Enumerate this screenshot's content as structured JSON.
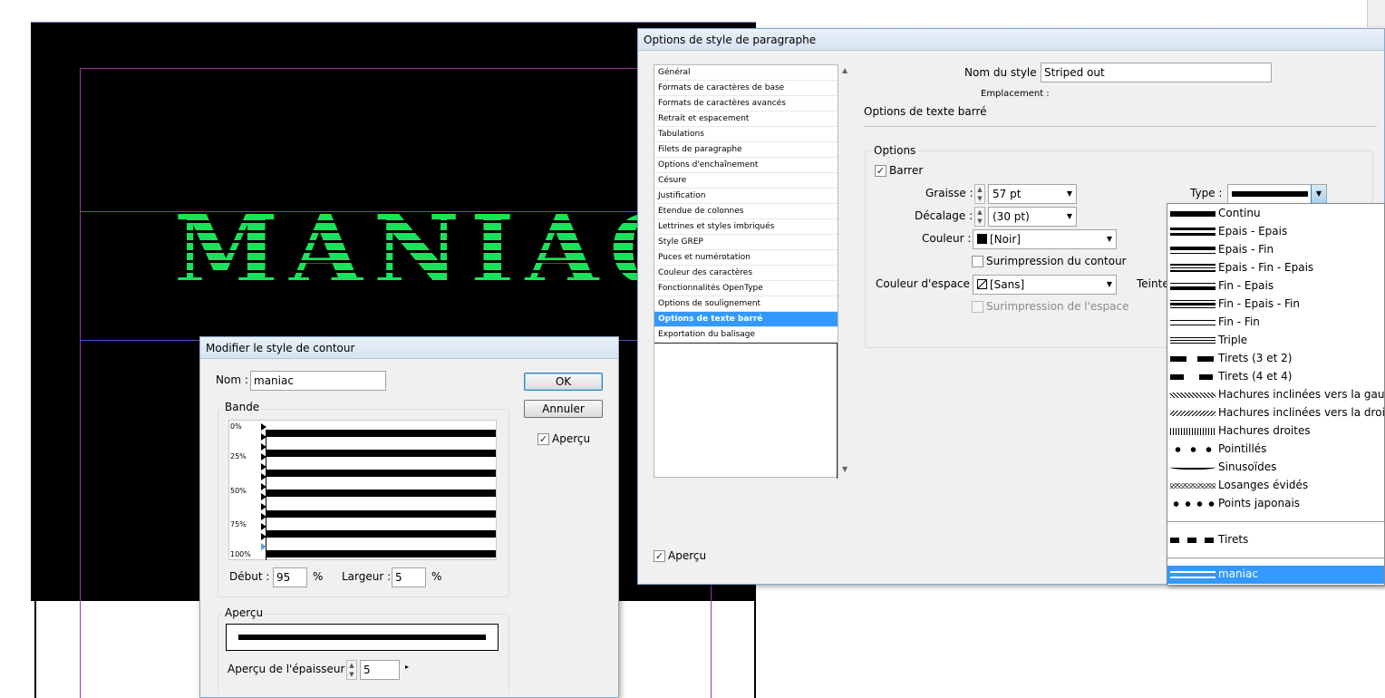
{
  "canvas": {
    "headline": "MANIAC",
    "headline_color": "#19e35a",
    "background_color": "#000000"
  },
  "para_dialog": {
    "title": "Options de style de paragraphe",
    "categories": [
      "Général",
      "Formats de caractères de base",
      "Formats de caractères avancés",
      "Retrait et espacement",
      "Tabulations",
      "Filets de paragraphe",
      "Options d'enchaînement",
      "Césure",
      "Justification",
      "Etendue de colonnes",
      "Lettrines et styles imbriqués",
      "Style GREP",
      "Puces et numérotation",
      "Couleur des caractères",
      "Fonctionnalités OpenType",
      "Options de soulignement",
      "Options de texte barré",
      "Exportation du balisage"
    ],
    "selected_category": "Options de texte barré",
    "style_name_label": "Nom du style :",
    "style_name_value": "Striped out",
    "location_label": "Emplacement :",
    "section_title": "Options de texte barré",
    "options_group_label": "Options",
    "strike_label": "Barrer",
    "strike_checked": true,
    "weight_label": "Graisse :",
    "weight_value": "57 pt",
    "offset_label": "Décalage :",
    "offset_value": "(30 pt)",
    "color_label": "Couleur :",
    "color_value": "[Noir]",
    "overprint_stroke_label": "Surimpression du contour",
    "gap_color_label": "Couleur d'espace :",
    "gap_color_value": "[Sans]",
    "overprint_gap_label": "Surimpression de l'espace",
    "type_label": "Type :",
    "tint_label": "Teinte",
    "preview_label": "Aperçu",
    "preview_checked": true
  },
  "type_dropdown": {
    "items": [
      "Continu",
      "Epais - Epais",
      "Epais - Fin",
      "Epais - Fin - Epais",
      "Fin - Epais",
      "Fin - Epais - Fin",
      "Fin - Fin",
      "Triple",
      "Tirets (3 et 2)",
      "Tirets (4 et 4)",
      "Hachures inclinées vers la gauche",
      "Hachures inclinées vers la droite",
      "Hachures droites",
      "Pointillés",
      "Sinusoïdes",
      "Losanges évidés",
      "Points japonais"
    ],
    "extra_item": "Tirets",
    "custom_item": "maniac",
    "selected_item": "maniac",
    "highlight_color": "#3399ff"
  },
  "stroke_dialog": {
    "title": "Modifier le style de contour",
    "name_label": "Nom :",
    "name_value": "maniac",
    "ok_label": "OK",
    "cancel_label": "Annuler",
    "preview_label": "Aperçu",
    "preview_checked": true,
    "band_group_label": "Bande",
    "band_ticks": [
      "0%",
      "25%",
      "50%",
      "75%",
      "100%"
    ],
    "start_label": "Début :",
    "start_value": "95",
    "width_label": "Largeur :",
    "width_value": "5",
    "percent_sign": "%",
    "preview_group_label": "Aperçu",
    "thickness_label": "Aperçu de l'épaisseur :",
    "thickness_value": "5"
  }
}
